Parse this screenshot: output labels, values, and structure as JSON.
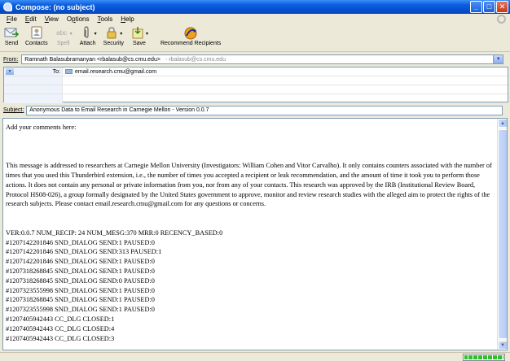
{
  "window": {
    "title": "Compose: (no subject)"
  },
  "menu": [
    {
      "pre": "",
      "key": "F",
      "post": "ile"
    },
    {
      "pre": "",
      "key": "E",
      "post": "dit"
    },
    {
      "pre": "",
      "key": "V",
      "post": "iew"
    },
    {
      "pre": "O",
      "key": "p",
      "post": "tions"
    },
    {
      "pre": "",
      "key": "T",
      "post": "ools"
    },
    {
      "pre": "",
      "key": "H",
      "post": "elp"
    }
  ],
  "toolbar": {
    "send": "Send",
    "contacts": "Contacts",
    "spell": "Spell",
    "attach": "Attach",
    "security": "Security",
    "save": "Save",
    "recommend": "Recommend Recipients"
  },
  "from": {
    "label": "From:",
    "value": "Ramnath Balasubramanyan <rbalasub@cs.cmu.edu>",
    "hint": "- rbalasub@cs.cmu.edu"
  },
  "recipients": [
    {
      "type": "To:",
      "address": "email.research.cmu@gmail.com"
    }
  ],
  "subject": {
    "label": "Subject:",
    "value": "Anonymous Data to Email Research in Carnegie Mellon - Version 0.0.7"
  },
  "body": {
    "comment": "Add your comments here:",
    "notice": "This message is addressed to researchers at Carnegie Mellon University (Investigators: William Cohen and Vitor Carvalho). It only contains counters associated with the number of times that you used this Thunderbird extension, i.e., the number of times you accepted a recipient or leak recommendation, and the amount of time it took you to perform those actions. It does not contain any personal or private information from you, nor from any of your contacts. This research was approved by the IRB (Institutional Review Board, Protocol HS08-026), a group formally designated by the United States government to approve, monitor and review research studies with the alleged aim to protect the rights of the research subjects. Please contact email.research.cmu@gmail.com for any questions or concerns.",
    "log": [
      "VER:0.0.7 NUM_RECIP: 24 NUM_MESG:370 MRR:0 RECENCY_BASED:0",
      "#1207142201846 SND_DIALOG SEND:1 PAUSED:0",
      "#1207142201846 SND_DIALOG SEND:313 PAUSED:1",
      "#1207142201846 SND_DIALOG SEND:1 PAUSED:0",
      "#1207318268845 SND_DIALOG SEND:1 PAUSED:0",
      "#1207318268845 SND_DIALOG SEND:0 PAUSED:0",
      "#1207323555998 SND_DIALOG SEND:1 PAUSED:0",
      "#1207318268845 SND_DIALOG SEND:1 PAUSED:0",
      "#1207323555998 SND_DIALOG SEND:1 PAUSED:0",
      "#1207405942443 CC_DLG CLOSED:1",
      "#1207405942443 CC_DLG CLOSED:4",
      "#1207405942443 CC_DLG CLOSED:3"
    ]
  },
  "status": {
    "progress": 1.0
  },
  "colors": {
    "titlebar": "#0a5fe0",
    "progress": "#2ec02e"
  }
}
